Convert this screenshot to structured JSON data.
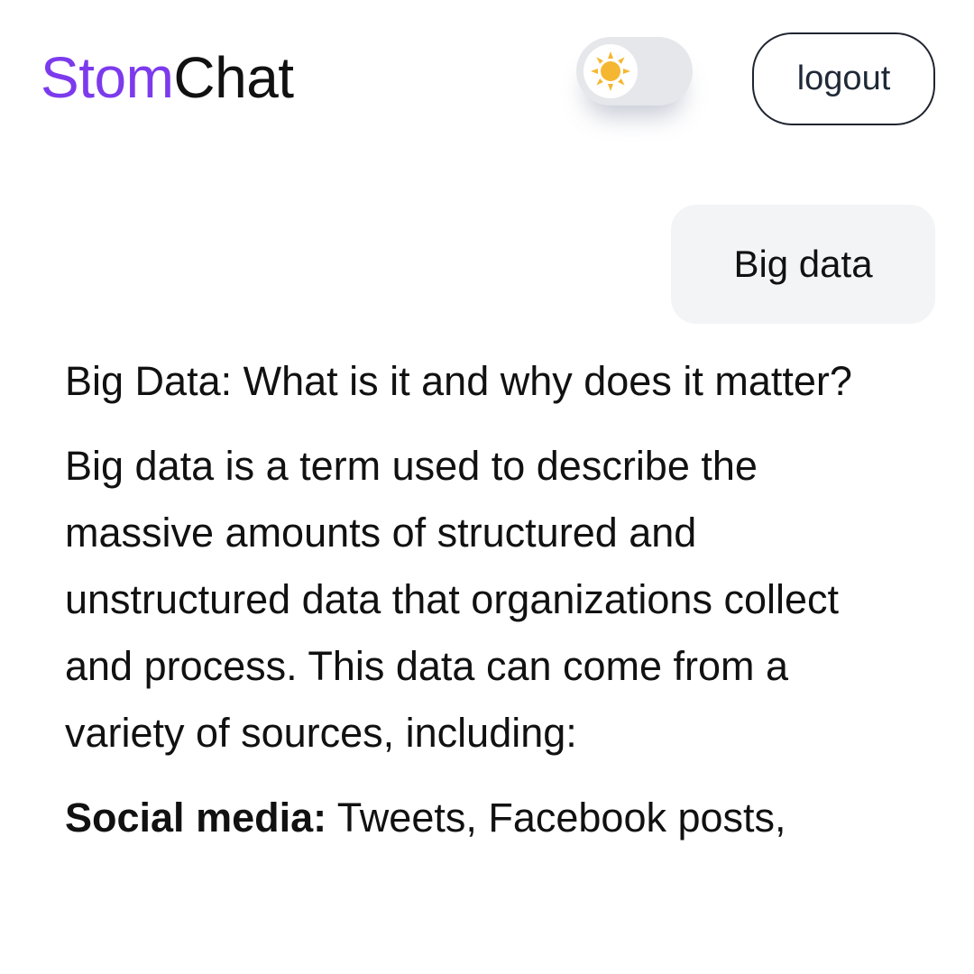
{
  "header": {
    "brand_accent": "Stom",
    "brand_main": "Chat",
    "logout_label": "logout",
    "theme_icon": "sun-icon"
  },
  "colors": {
    "brand_accent": "#7c3aed",
    "sun": "#f5b731",
    "toggle_track": "#e5e7eb",
    "user_bubble": "#f3f4f6"
  },
  "messages": {
    "user": "Big data",
    "assistant": {
      "heading": "Big Data: What is it and why does it matter?",
      "paragraph": "Big data is a term used to describe the massive amounts of structured and unstructured data that organizations collect and process. This data can come from a variety of sources, including:",
      "list_item_label": "Social media:",
      "list_item_text": " Tweets, Facebook posts,"
    }
  }
}
